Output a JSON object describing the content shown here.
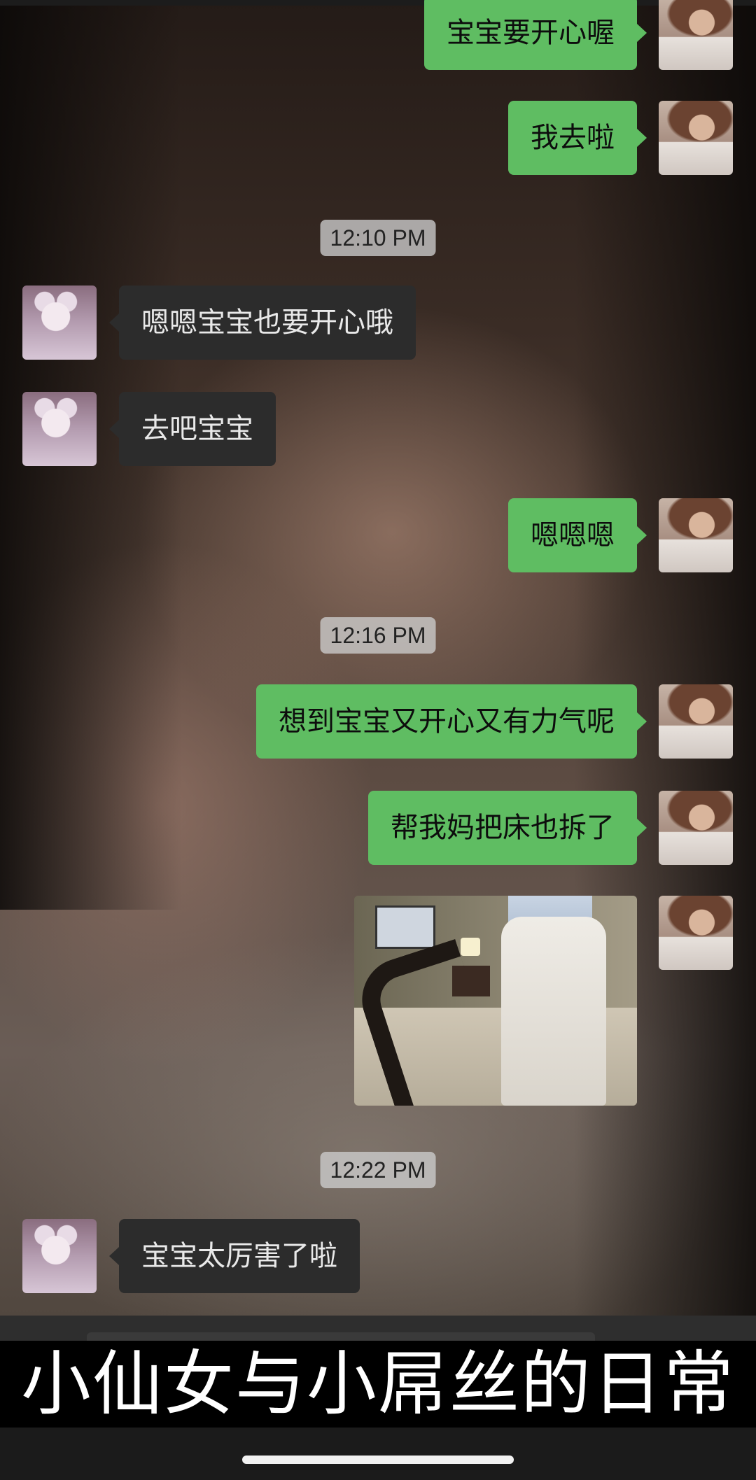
{
  "chat": {
    "messages": [
      {
        "side": "sent",
        "text": "宝宝要开心喔"
      },
      {
        "side": "sent",
        "text": "我去啦"
      },
      {
        "type": "time",
        "text": "12:10 PM"
      },
      {
        "side": "recv",
        "text": "嗯嗯宝宝也要开心哦"
      },
      {
        "side": "recv",
        "text": "去吧宝宝"
      },
      {
        "side": "sent",
        "text": "嗯嗯嗯"
      },
      {
        "type": "time",
        "text": "12:16 PM"
      },
      {
        "side": "sent",
        "text": "想到宝宝又开心又有力气呢"
      },
      {
        "side": "sent",
        "text": "帮我妈把床也拆了"
      },
      {
        "side": "sent",
        "type": "image"
      },
      {
        "type": "time",
        "text": "12:22 PM"
      },
      {
        "side": "recv",
        "text": "宝宝太厉害了啦"
      }
    ]
  },
  "caption": "小仙女与小屌丝的日常",
  "colors": {
    "sent_bubble": "#5fbd62",
    "recv_bubble": "#2c2c2c",
    "timestamp_bg": "#cdcdcd",
    "caption_bg": "#000000",
    "caption_text": "#ffffff"
  }
}
